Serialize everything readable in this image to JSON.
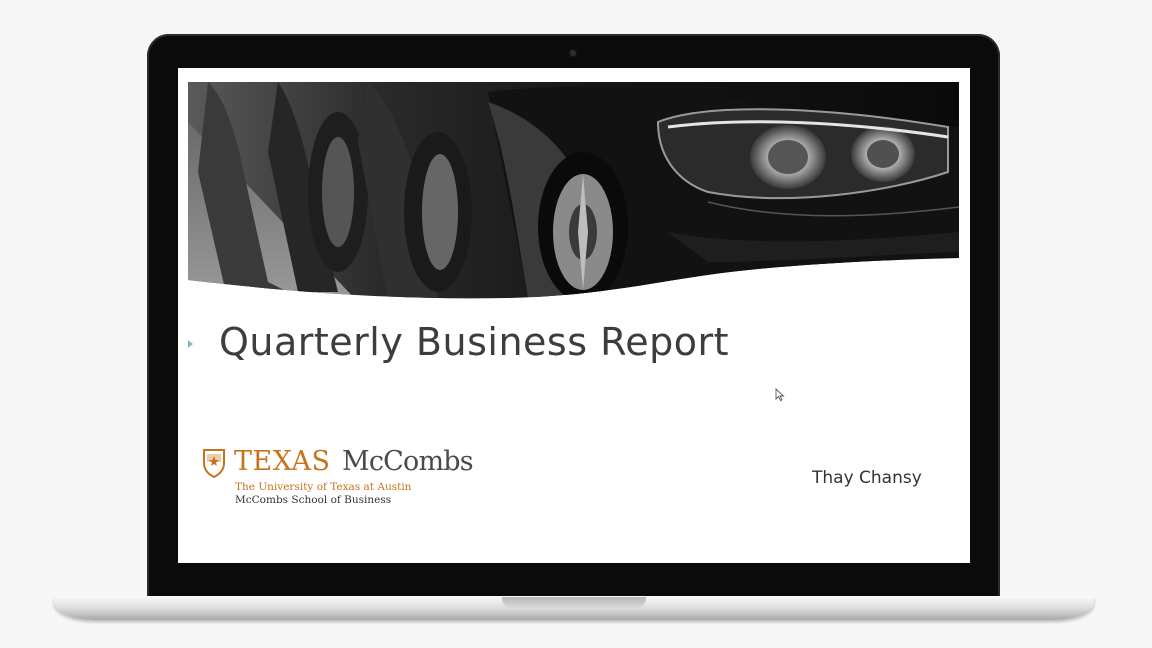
{
  "slide": {
    "title": "Quarterly Business Report",
    "presenter": "Thay Chansy"
  },
  "logo": {
    "texas": "TEXAS",
    "mccombs": "McCombs",
    "university": "The University of Texas at Austin",
    "school": "McCombs School of Business"
  },
  "colors": {
    "texas_orange": "#c7731c",
    "title_gray": "#3d3d3d",
    "bullet_teal": "#8fb4c0"
  },
  "icons": {
    "bullet": "triangle-right-icon",
    "cursor": "mouse-pointer-icon",
    "shield": "ut-shield-icon"
  }
}
